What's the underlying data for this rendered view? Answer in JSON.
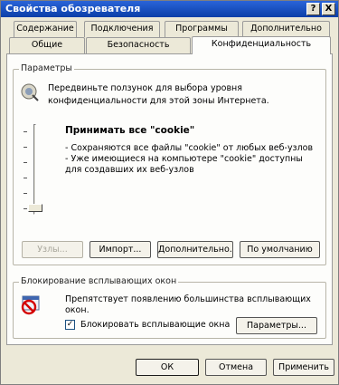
{
  "window": {
    "title": "Свойства обозревателя",
    "help_label": "?",
    "close_label": "X"
  },
  "tabs_row1": [
    {
      "label": "Содержание"
    },
    {
      "label": "Подключения"
    },
    {
      "label": "Программы"
    },
    {
      "label": "Дополнительно"
    }
  ],
  "tabs_row2": [
    {
      "label": "Общие"
    },
    {
      "label": "Безопасность"
    },
    {
      "label": "Конфиденциальность"
    }
  ],
  "settings": {
    "legend": "Параметры",
    "hint_line1": "Передвиньте ползунок для выбора уровня",
    "hint_line2": "конфиденциальности для этой зоны Интернета.",
    "level_title": "Принимать все \"cookie\"",
    "desc_line1": "- Сохраняются все файлы \"cookie\" от любых веб-узлов",
    "desc_line2": "- Уже имеющиеся на компьютере \"cookie\" доступны",
    "desc_line3": "для создавших их веб-узлов",
    "buttons": {
      "sites": "Узлы...",
      "import": "Импорт...",
      "advanced": "Дополнительно...",
      "default": "По умолчанию"
    }
  },
  "popup": {
    "legend": "Блокирование всплывающих окон",
    "hint_line1": "Препятствует появлению большинства всплывающих",
    "hint_line2": "окон.",
    "checkbox_label": "Блокировать всплывающие окна",
    "checkbox_checked": true,
    "params_button": "Параметры..."
  },
  "footer": {
    "ok": "ОК",
    "cancel": "Отмена",
    "apply": "Применить"
  }
}
